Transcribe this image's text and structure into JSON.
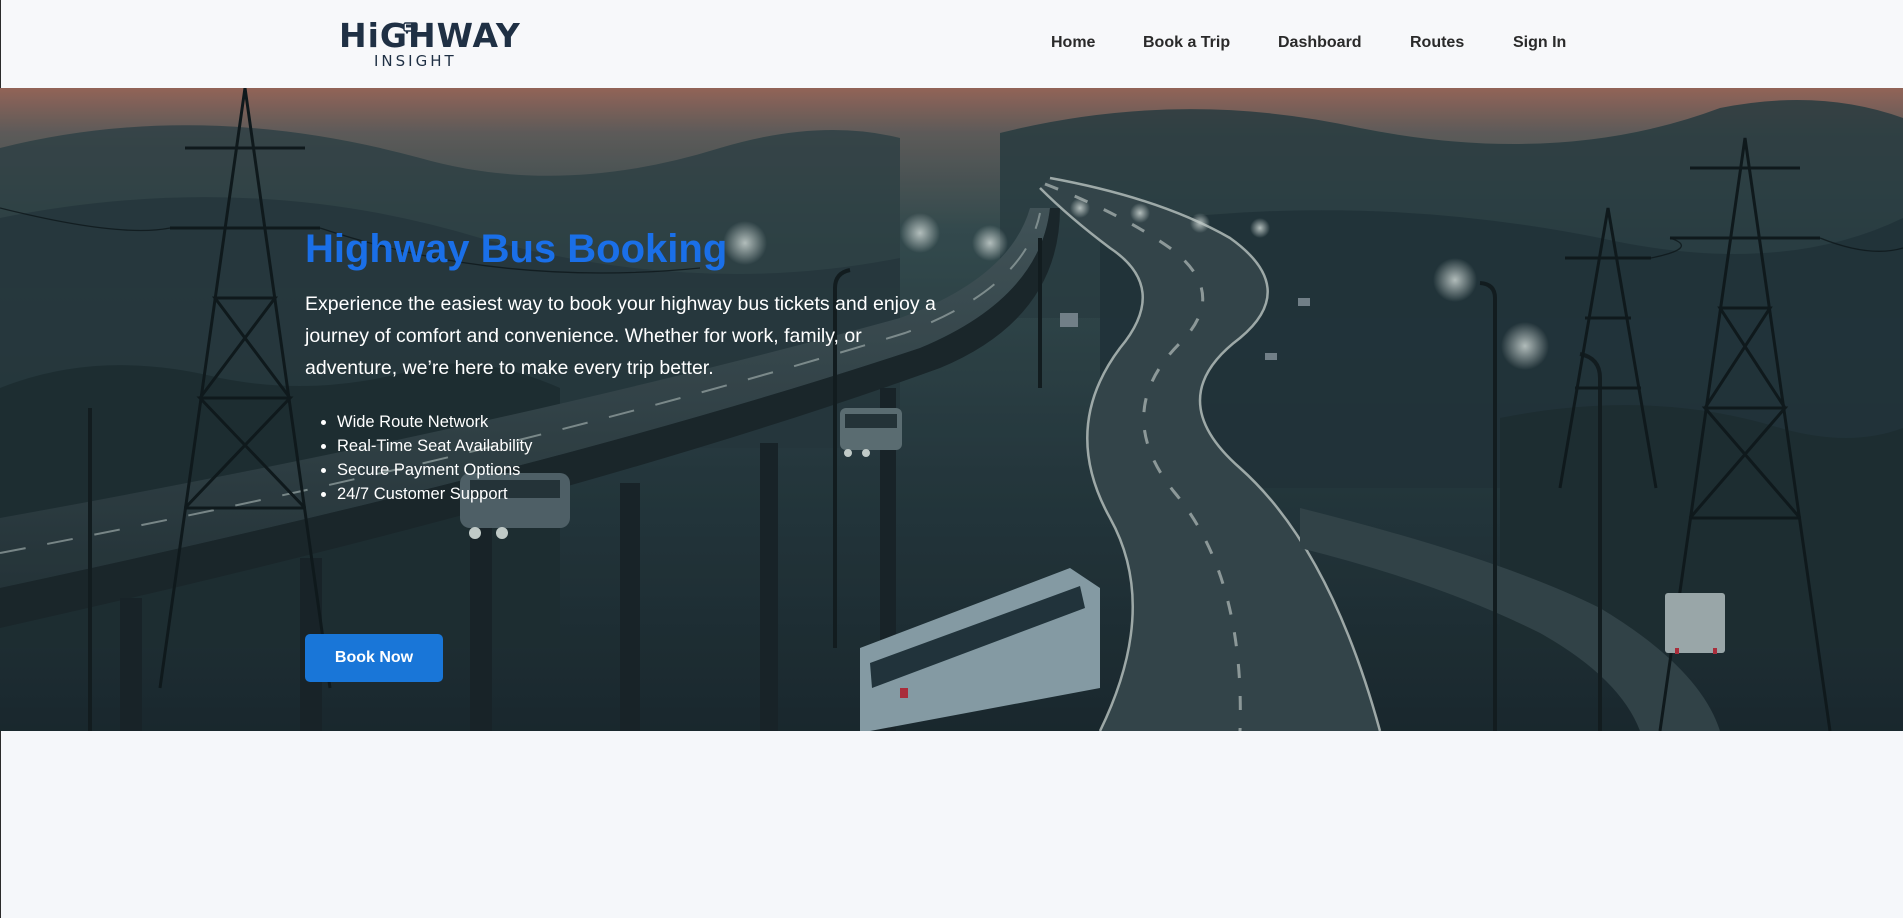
{
  "header": {
    "logo": {
      "main": "HiGHWAY",
      "sub": "INSIGHT"
    },
    "nav": [
      {
        "label": "Home"
      },
      {
        "label": "Book a Trip"
      },
      {
        "label": "Dashboard"
      },
      {
        "label": "Routes"
      },
      {
        "label": "Sign In"
      }
    ]
  },
  "hero": {
    "title": "Highway Bus Booking",
    "description": "Experience the easiest way to book your highway bus tickets and enjoy a journey of comfort and convenience. Whether for work, family, or adventure, we’re here to make every trip better.",
    "features": [
      "Wide Route Network",
      "Real-Time Seat Availability",
      "Secure Payment Options",
      "24/7 Customer Support"
    ],
    "cta_label": "Book Now",
    "background_icon": "night-highway-illustration"
  },
  "colors": {
    "title_blue": "#1a6fe8",
    "button_blue": "#1976d8",
    "header_bg": "#f7f8fa",
    "page_bg": "#f5f7fa"
  }
}
